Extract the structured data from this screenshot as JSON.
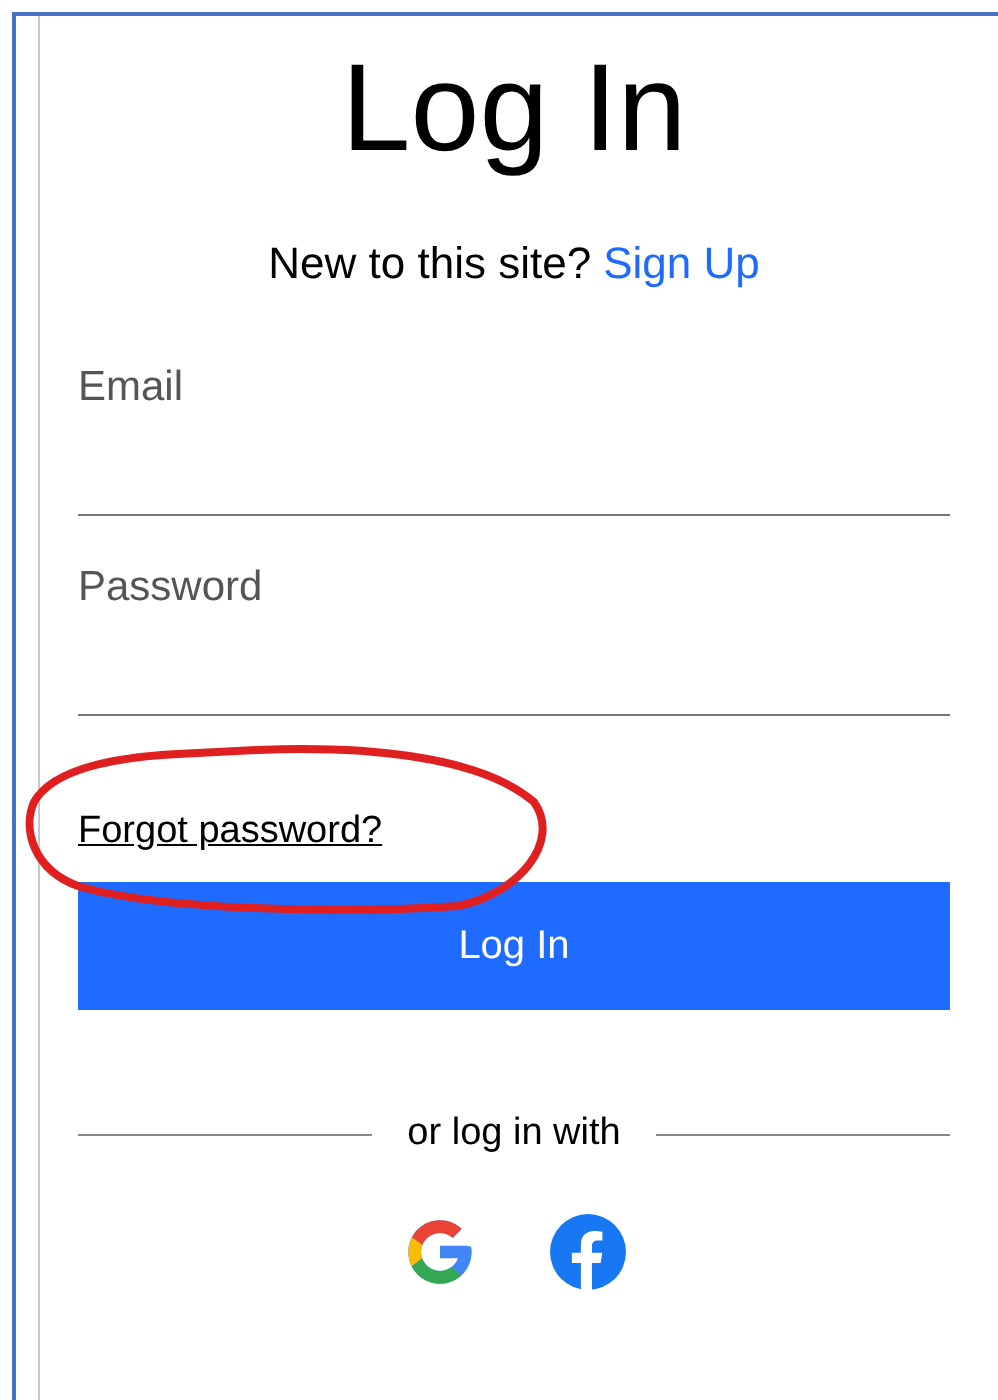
{
  "title": "Log In",
  "signup_prompt": {
    "text": "New to this site?",
    "link": "Sign Up"
  },
  "fields": [
    {
      "label": "Email"
    },
    {
      "label": "Password"
    }
  ],
  "forgot_link": "Forgot password?",
  "submit_button": "Log In",
  "divider_text": "or log in with"
}
